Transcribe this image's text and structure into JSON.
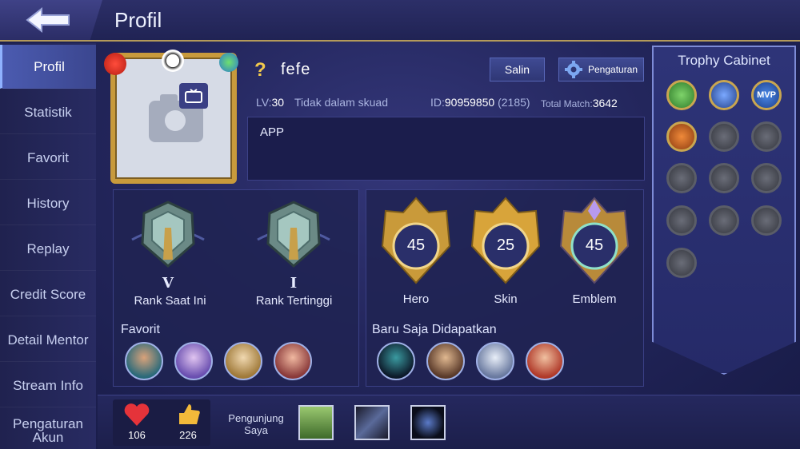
{
  "header": {
    "title": "Profil"
  },
  "sidebar": {
    "items": [
      {
        "label": "Profil",
        "active": true
      },
      {
        "label": "Statistik"
      },
      {
        "label": "Favorit"
      },
      {
        "label": "History"
      },
      {
        "label": "Replay"
      },
      {
        "label": "Credit Score"
      },
      {
        "label": "Detail Mentor"
      },
      {
        "label": "Stream Info"
      },
      {
        "label": "Pengaturan Akun"
      }
    ]
  },
  "profile": {
    "question_mark": "?",
    "name": "fefe",
    "copy_label": "Salin",
    "settings_label": "Pengaturan",
    "lv_label": "LV:",
    "level": "30",
    "squad_status": "Tidak dalam skuad",
    "id_label": "ID:",
    "id": "90959850",
    "server": "(2185)",
    "total_match_label": "Total Match:",
    "total_match": "3642",
    "bio": "APP"
  },
  "ranks": [
    {
      "tier": "V",
      "label": "Rank Saat Ini"
    },
    {
      "tier": "I",
      "label": "Rank Tertinggi"
    }
  ],
  "collection": [
    {
      "count": "45",
      "label": "Hero"
    },
    {
      "count": "25",
      "label": "Skin"
    },
    {
      "count": "45",
      "label": "Emblem"
    }
  ],
  "favorite": {
    "title": "Favorit",
    "heroes": [
      "hero-1",
      "hero-2",
      "hero-3",
      "hero-4"
    ]
  },
  "recent": {
    "title": "Baru Saja Didapatkan",
    "heroes": [
      "hero-a",
      "hero-b",
      "hero-c",
      "hero-d"
    ]
  },
  "trophy": {
    "title": "Trophy Cabinet",
    "mvp_label": "MVP"
  },
  "stats": {
    "likes": "106",
    "thumbs": "226"
  },
  "visitors": {
    "label": "Pengunjung Saya"
  },
  "colors": {
    "accent": "#b49a5a",
    "active_tab": "#4b5bb0",
    "gold": "#f2c94c"
  }
}
